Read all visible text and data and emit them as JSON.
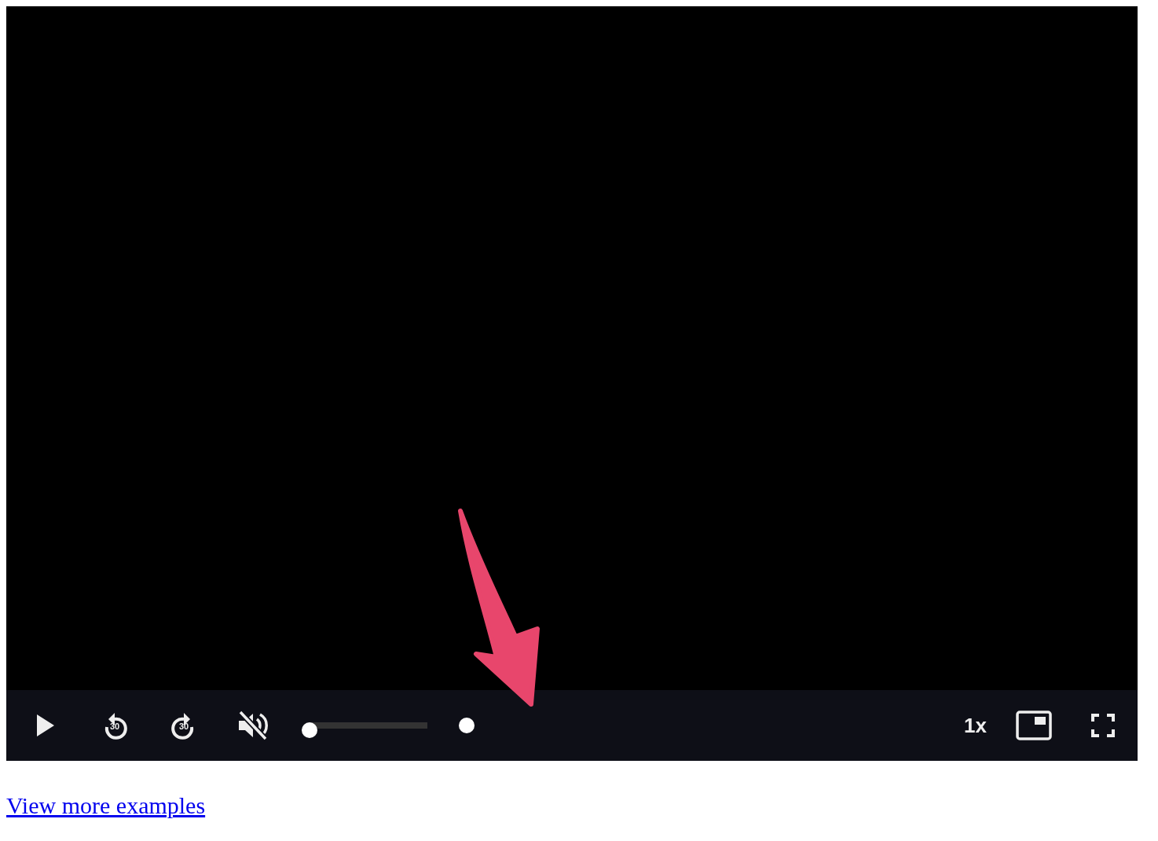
{
  "player": {
    "playing": false,
    "skip_back": "30",
    "skip_forward": "30",
    "muted": true,
    "volume": {
      "level": 0
    },
    "speed": "1x"
  },
  "annotation": {
    "kind": "arrow"
  },
  "link": "View more examples"
}
